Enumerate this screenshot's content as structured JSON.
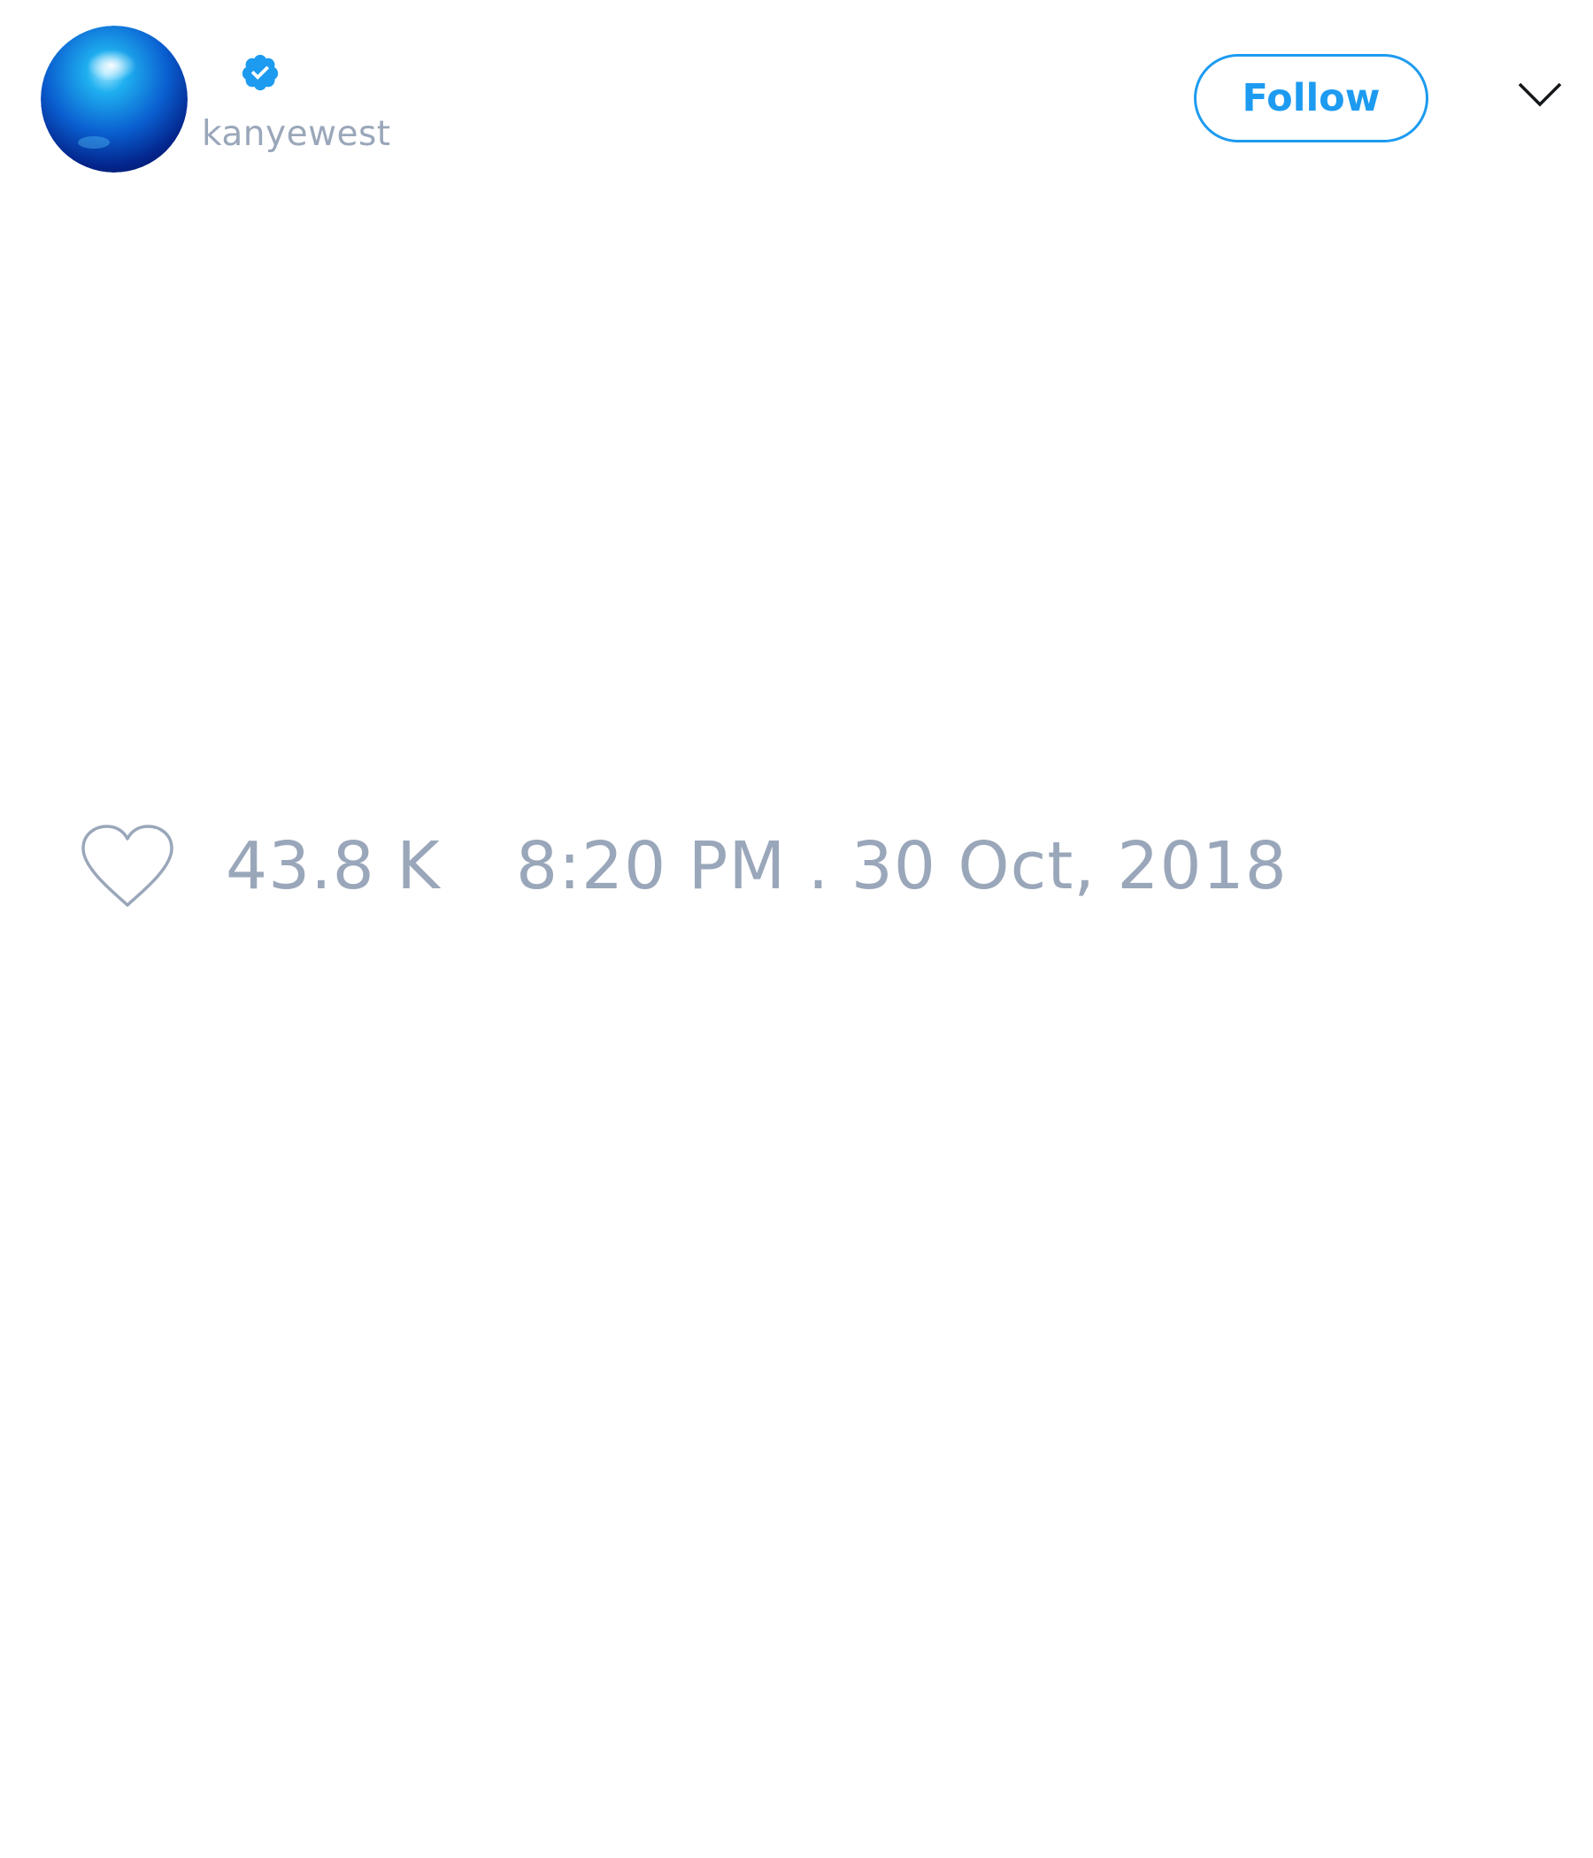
{
  "tweet": {
    "author": {
      "handle": "kanyewest",
      "verified": true,
      "avatar_icon": "blue-sphere-avatar",
      "verified_icon": "verified-badge-icon"
    },
    "follow_label": "Follow",
    "menu_icon": "chevron-down-icon",
    "like_icon": "heart-icon",
    "like_count": "43.8 K",
    "timestamp": "8:20 PM . 30 Oct, 2018"
  },
  "colors": {
    "accent": "#1d9bf0",
    "muted_text": "#9aa7ba",
    "background": "#ffffff",
    "icon_dark": "#14171a"
  }
}
